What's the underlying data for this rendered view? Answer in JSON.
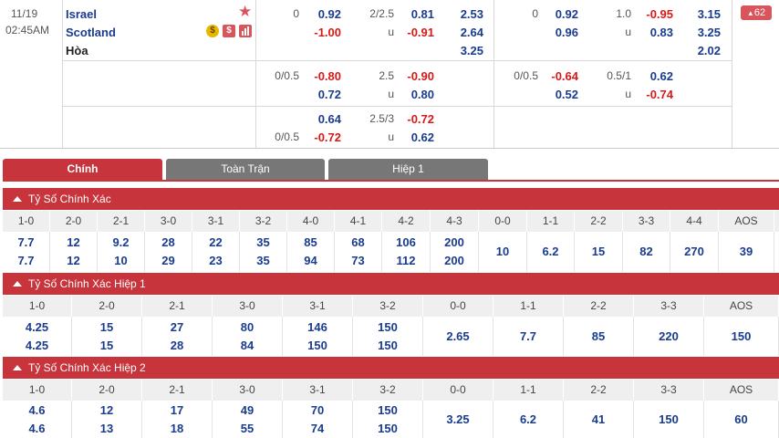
{
  "match": {
    "date": "11/19",
    "time": "02:45AM",
    "home": "Israel",
    "away": "Scotland",
    "draw": "Hòa",
    "badge_count": "62",
    "icons": [
      "star-icon",
      "coin-icon",
      "dollar-icon",
      "stats-icon"
    ]
  },
  "odds": {
    "row1": {
      "ft": {
        "hdp_line": "0",
        "hdp_home": "0.92",
        "hdp_away": "-1.00",
        "ou_line": "2/2.5",
        "ou_over": "0.81",
        "ou_u": "u",
        "ou_under": "-0.91",
        "x12_home": "2.53",
        "x12_away": "2.64",
        "x12_draw": "3.25"
      },
      "h1": {
        "hdp_line": "0",
        "hdp_home": "0.92",
        "hdp_away": "0.96",
        "ou_line": "1.0",
        "ou_over": "-0.95",
        "ou_u": "u",
        "ou_under": "0.83",
        "x12_home": "3.15",
        "x12_away": "3.25",
        "x12_draw": "2.02"
      }
    },
    "row2": {
      "ft": {
        "hdp_line": "0/0.5",
        "hdp_home": "-0.80",
        "hdp_away": "0.72",
        "ou_line": "2.5",
        "ou_over": "-0.90",
        "ou_u": "u",
        "ou_under": "0.80"
      },
      "h1": {
        "hdp_line": "0/0.5",
        "hdp_home": "-0.64",
        "hdp_away": "0.52",
        "ou_line": "0.5/1",
        "ou_over": "0.62",
        "ou_u": "u",
        "ou_under": "-0.74"
      }
    },
    "row3": {
      "ft": {
        "hdp_line": "0/0.5",
        "hdp_home": "0.64",
        "hdp_away": "-0.72",
        "ou_line": "2.5/3",
        "ou_over": "-0.72",
        "ou_u": "u",
        "ou_under": "0.62"
      }
    }
  },
  "tabs": [
    "Chính",
    "Toàn Trận",
    "Hiệp 1"
  ],
  "sections": [
    {
      "title": "Tỷ Số Chính Xác",
      "headers": [
        "1-0",
        "2-0",
        "2-1",
        "3-0",
        "3-1",
        "3-2",
        "4-0",
        "4-1",
        "4-2",
        "4-3",
        "0-0",
        "1-1",
        "2-2",
        "3-3",
        "4-4",
        "AOS"
      ],
      "top": [
        "7.7",
        "12",
        "9.2",
        "28",
        "22",
        "35",
        "85",
        "68",
        "106",
        "200",
        "10",
        "6.2",
        "15",
        "82",
        "270",
        "39"
      ],
      "bottom": [
        "7.7",
        "12",
        "10",
        "29",
        "23",
        "35",
        "94",
        "73",
        "112",
        "200",
        "",
        "",
        "",
        "",
        "",
        ""
      ]
    },
    {
      "title": "Tỷ Số Chính Xác Hiệp 1",
      "headers": [
        "1-0",
        "2-0",
        "2-1",
        "3-0",
        "3-1",
        "3-2",
        "0-0",
        "1-1",
        "2-2",
        "3-3",
        "AOS"
      ],
      "top": [
        "4.25",
        "15",
        "27",
        "80",
        "146",
        "150",
        "2.65",
        "7.7",
        "85",
        "220",
        "150"
      ],
      "bottom": [
        "4.25",
        "15",
        "28",
        "84",
        "150",
        "150",
        "",
        "",
        "",
        "",
        ""
      ]
    },
    {
      "title": "Tỷ Số Chính Xác Hiệp 2",
      "headers": [
        "1-0",
        "2-0",
        "2-1",
        "3-0",
        "3-1",
        "3-2",
        "0-0",
        "1-1",
        "2-2",
        "3-3",
        "AOS"
      ],
      "top": [
        "4.6",
        "12",
        "17",
        "49",
        "70",
        "150",
        "3.25",
        "6.2",
        "41",
        "150",
        "60"
      ],
      "bottom": [
        "4.6",
        "13",
        "18",
        "55",
        "74",
        "150",
        "",
        "",
        "",
        "",
        ""
      ]
    }
  ]
}
